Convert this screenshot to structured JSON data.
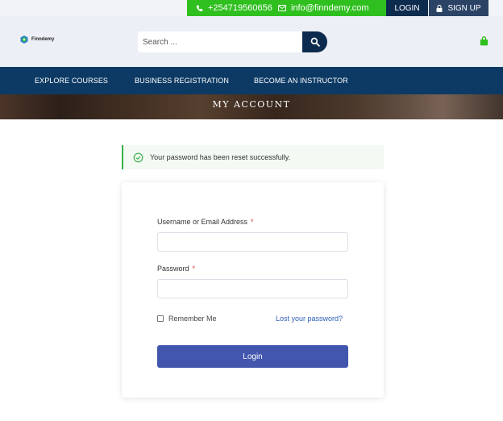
{
  "topbar": {
    "phone": "+254719560656",
    "email": "info@finndemy.com",
    "login_label": "LOGIN",
    "signup_label": "SIGN UP"
  },
  "header": {
    "logo_text": "Finndemy",
    "search_placeholder": "Search ..."
  },
  "nav": {
    "items": [
      {
        "label": "EXPLORE COURSES"
      },
      {
        "label": "BUSINESS REGISTRATION"
      },
      {
        "label": "BECOME AN INSTRUCTOR"
      }
    ]
  },
  "banner": {
    "title": "MY ACCOUNT"
  },
  "notice": {
    "message": "Your password has been reset successfully."
  },
  "form": {
    "username_label": "Username or Email Address",
    "password_label": "Password",
    "required_mark": "*",
    "username_value": "",
    "password_value": "",
    "remember_label": "Remember Me",
    "lost_password_label": "Lost your password?",
    "login_button_label": "Login"
  },
  "colors": {
    "green": "#2fbf1f",
    "navy": "#0d2b4e",
    "nav_blue": "#0d3a64",
    "button_blue": "#4256ad",
    "link_blue": "#2e5db8"
  }
}
